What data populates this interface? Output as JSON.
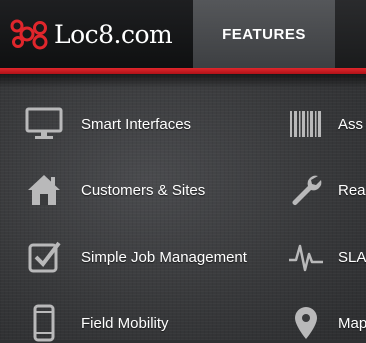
{
  "header": {
    "logo_text": "Loc8.com",
    "tab_label": "FEATURES",
    "accent_color": "#e0262c"
  },
  "features": {
    "left": [
      {
        "label": "Smart Interfaces",
        "icon": "monitor-icon"
      },
      {
        "label": "Customers & Sites",
        "icon": "house-icon"
      },
      {
        "label": "Simple Job Management",
        "icon": "checkbox-icon"
      },
      {
        "label": "Field Mobility",
        "icon": "smartphone-icon"
      }
    ],
    "right": [
      {
        "label": "Ass",
        "icon": "barcode-icon"
      },
      {
        "label": "Rea",
        "icon": "wrench-icon"
      },
      {
        "label": "SLA",
        "icon": "pulse-icon"
      },
      {
        "label": "Map",
        "icon": "map-pin-icon"
      }
    ]
  }
}
